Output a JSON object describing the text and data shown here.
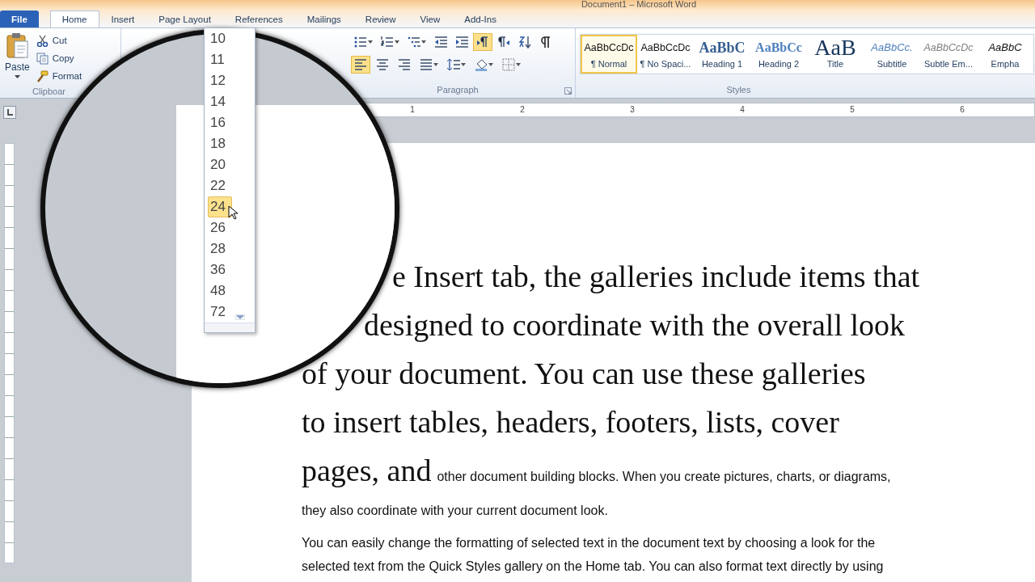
{
  "window": {
    "title": "Document1 – Microsoft Word"
  },
  "tabs": [
    {
      "label": "File",
      "kind": "file",
      "selected": false
    },
    {
      "label": "Home",
      "kind": "tab",
      "selected": true
    },
    {
      "label": "Insert",
      "kind": "tab",
      "selected": false
    },
    {
      "label": "Page Layout",
      "kind": "tab",
      "selected": false
    },
    {
      "label": "References",
      "kind": "tab",
      "selected": false
    },
    {
      "label": "Mailings",
      "kind": "tab",
      "selected": false
    },
    {
      "label": "Review",
      "kind": "tab",
      "selected": false
    },
    {
      "label": "View",
      "kind": "tab",
      "selected": false
    },
    {
      "label": "Add-Ins",
      "kind": "tab",
      "selected": false
    }
  ],
  "clipboard": {
    "paste": "Paste",
    "commands": [
      {
        "label": "Cut",
        "kind": "cut"
      },
      {
        "label": "Copy",
        "kind": "copy"
      },
      {
        "label": "Format",
        "kind": "painter"
      }
    ],
    "group_label": "Clipboar"
  },
  "paragraph": {
    "rows": [
      [
        {
          "kind": "bullets",
          "selected": false
        },
        {
          "kind": "numbering",
          "selected": false
        },
        {
          "kind": "multilevel",
          "selected": false
        },
        {
          "kind": "outdent",
          "selected": false
        },
        {
          "kind": "indent",
          "selected": false
        },
        {
          "kind": "ltr",
          "selected": true
        },
        {
          "kind": "rtl",
          "selected": false
        },
        {
          "kind": "sort",
          "selected": false
        },
        {
          "kind": "pilcrow",
          "selected": false
        }
      ],
      [
        {
          "kind": "left",
          "selected": true
        },
        {
          "kind": "center",
          "selected": false
        },
        {
          "kind": "right",
          "selected": false
        },
        {
          "kind": "justify",
          "selected": false
        },
        {
          "kind": "spacing",
          "selected": false
        },
        {
          "kind": "shading",
          "selected": false
        },
        {
          "kind": "borders",
          "selected": false
        }
      ]
    ],
    "group_label": "Paragraph"
  },
  "styles": {
    "items": [
      {
        "preview": "AaBbCcDc",
        "label": "¶ Normal",
        "kind": "normal",
        "selected": true
      },
      {
        "preview": "AaBbCcDc",
        "label": "¶ No Spaci...",
        "kind": "normal",
        "selected": false
      },
      {
        "preview": "AaBbC",
        "label": "Heading 1",
        "kind": "heading1",
        "selected": false
      },
      {
        "preview": "AaBbCc",
        "label": "Heading 2",
        "kind": "heading2",
        "selected": false
      },
      {
        "preview": "AaB",
        "label": "Title",
        "kind": "title",
        "selected": false
      },
      {
        "preview": "AaBbCc.",
        "label": "Subtitle",
        "kind": "subtitle",
        "selected": false
      },
      {
        "preview": "AaBbCcDc",
        "label": "Subtle Em...",
        "kind": "subtle",
        "selected": false
      },
      {
        "preview": "AaBbC",
        "label": "Empha",
        "kind": "emphasis",
        "selected": false
      }
    ],
    "group_label": "Styles"
  },
  "ruler": {
    "numbers": [
      "1",
      "2",
      "3",
      "4",
      "5",
      "6"
    ]
  },
  "font_size_menu": {
    "items": [
      {
        "label": "10",
        "selected": false
      },
      {
        "label": "11",
        "selected": false
      },
      {
        "label": "12",
        "selected": false
      },
      {
        "label": "14",
        "selected": false
      },
      {
        "label": "16",
        "selected": false
      },
      {
        "label": "18",
        "selected": false
      },
      {
        "label": "20",
        "selected": false
      },
      {
        "label": "22",
        "selected": false
      },
      {
        "label": "24",
        "selected": true
      },
      {
        "label": "26",
        "selected": false
      },
      {
        "label": "28",
        "selected": false
      },
      {
        "label": "36",
        "selected": false
      },
      {
        "label": "48",
        "selected": false
      },
      {
        "label": "72",
        "selected": false
      }
    ]
  },
  "document": {
    "paragraphs": [
      {
        "lines": [
          [
            {
              "kind": "large",
              "text": "e Insert tab, the galleries include items that"
            }
          ],
          [
            {
              "kind": "large",
              "text": "designed to coordinate with the overall look"
            }
          ],
          [
            {
              "kind": "large",
              "text": "of your document.  You can use these galleries"
            }
          ],
          [
            {
              "kind": "large",
              "text": "to insert tables, headers, footers, lists, cover"
            }
          ],
          [
            {
              "kind": "large",
              "text": "pages, and"
            },
            {
              "kind": "small",
              "text": "other document building blocks. When you create pictures, charts, or diagrams,"
            }
          ],
          [
            {
              "kind": "small",
              "text": "they also coordinate with your current document look."
            }
          ]
        ]
      },
      {
        "lines": [
          [
            {
              "kind": "small",
              "text": "You can easily change the formatting of selected text in the document text by choosing a look for the"
            }
          ],
          [
            {
              "kind": "small",
              "text": "selected text from the Quick Styles gallery on the Home tab. You can also format text directly by using"
            }
          ]
        ]
      }
    ]
  }
}
